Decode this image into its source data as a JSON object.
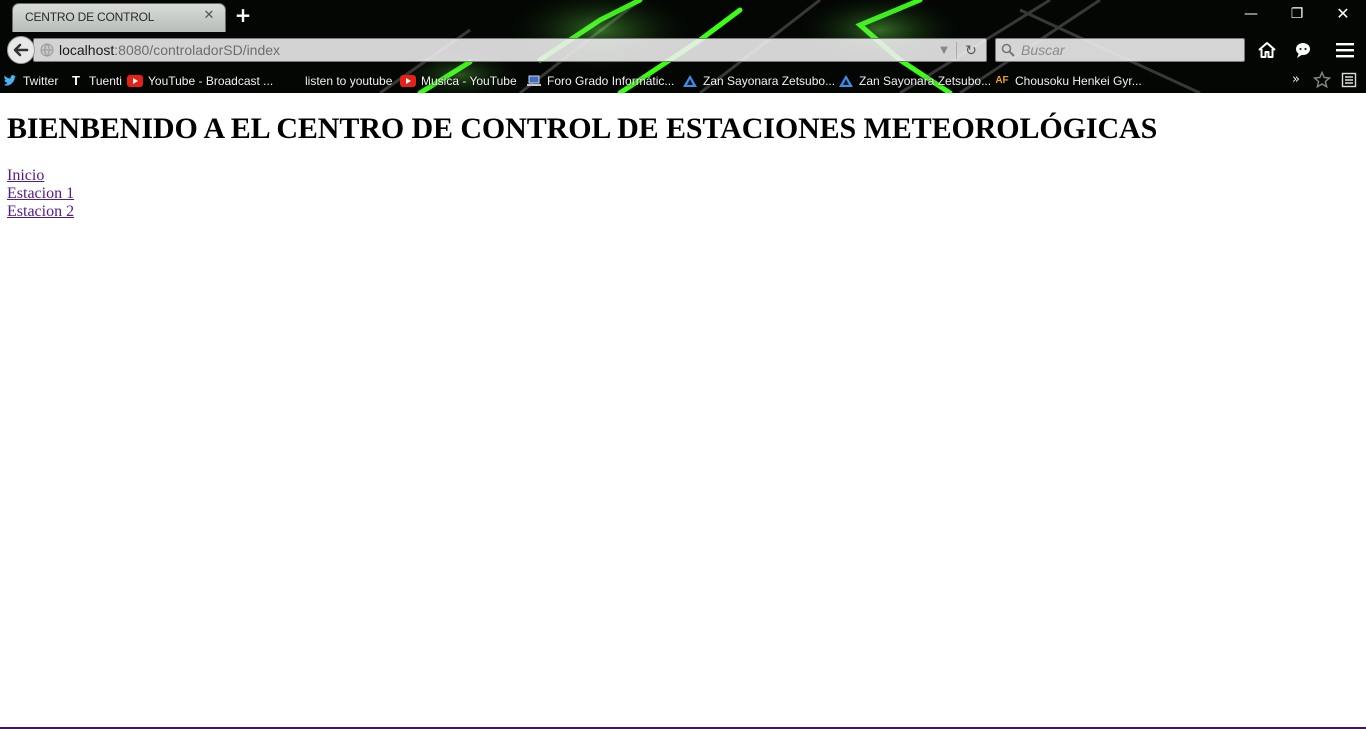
{
  "browser": {
    "tab": {
      "title": "CENTRO DE CONTROL"
    },
    "url": {
      "host": "localhost",
      "path": ":8080/controladorSD/index"
    },
    "search": {
      "placeholder": "Buscar"
    },
    "bookmarks": [
      {
        "label": "Twitter",
        "icon": "twitter-icon"
      },
      {
        "label": "Tuenti",
        "icon": "tuenti-icon"
      },
      {
        "label": "YouTube - Broadcast ...",
        "icon": "youtube-icon"
      },
      {
        "label": "listen to youtube",
        "icon": "blank-icon"
      },
      {
        "label": "Musica - YouTube",
        "icon": "youtube-icon"
      },
      {
        "label": "Foro Grado Informátic...",
        "icon": "laptop-icon"
      },
      {
        "label": "Zan Sayonara Zetsubo...",
        "icon": "triangle-icon"
      },
      {
        "label": "Zan Sayonara Zetsubo...",
        "icon": "triangle-icon"
      },
      {
        "label": "Chousoku Henkei Gyr...",
        "icon": "af-icon"
      }
    ],
    "colors": {
      "accent": "#39ff14",
      "link_visited": "#551a8b"
    }
  },
  "page": {
    "heading": "BIENBENIDO A EL CENTRO DE CONTROL DE ESTACIONES METEOROLÓGICAS",
    "links": [
      "Inicio",
      "Estacion 1",
      "Estacion 2"
    ]
  }
}
